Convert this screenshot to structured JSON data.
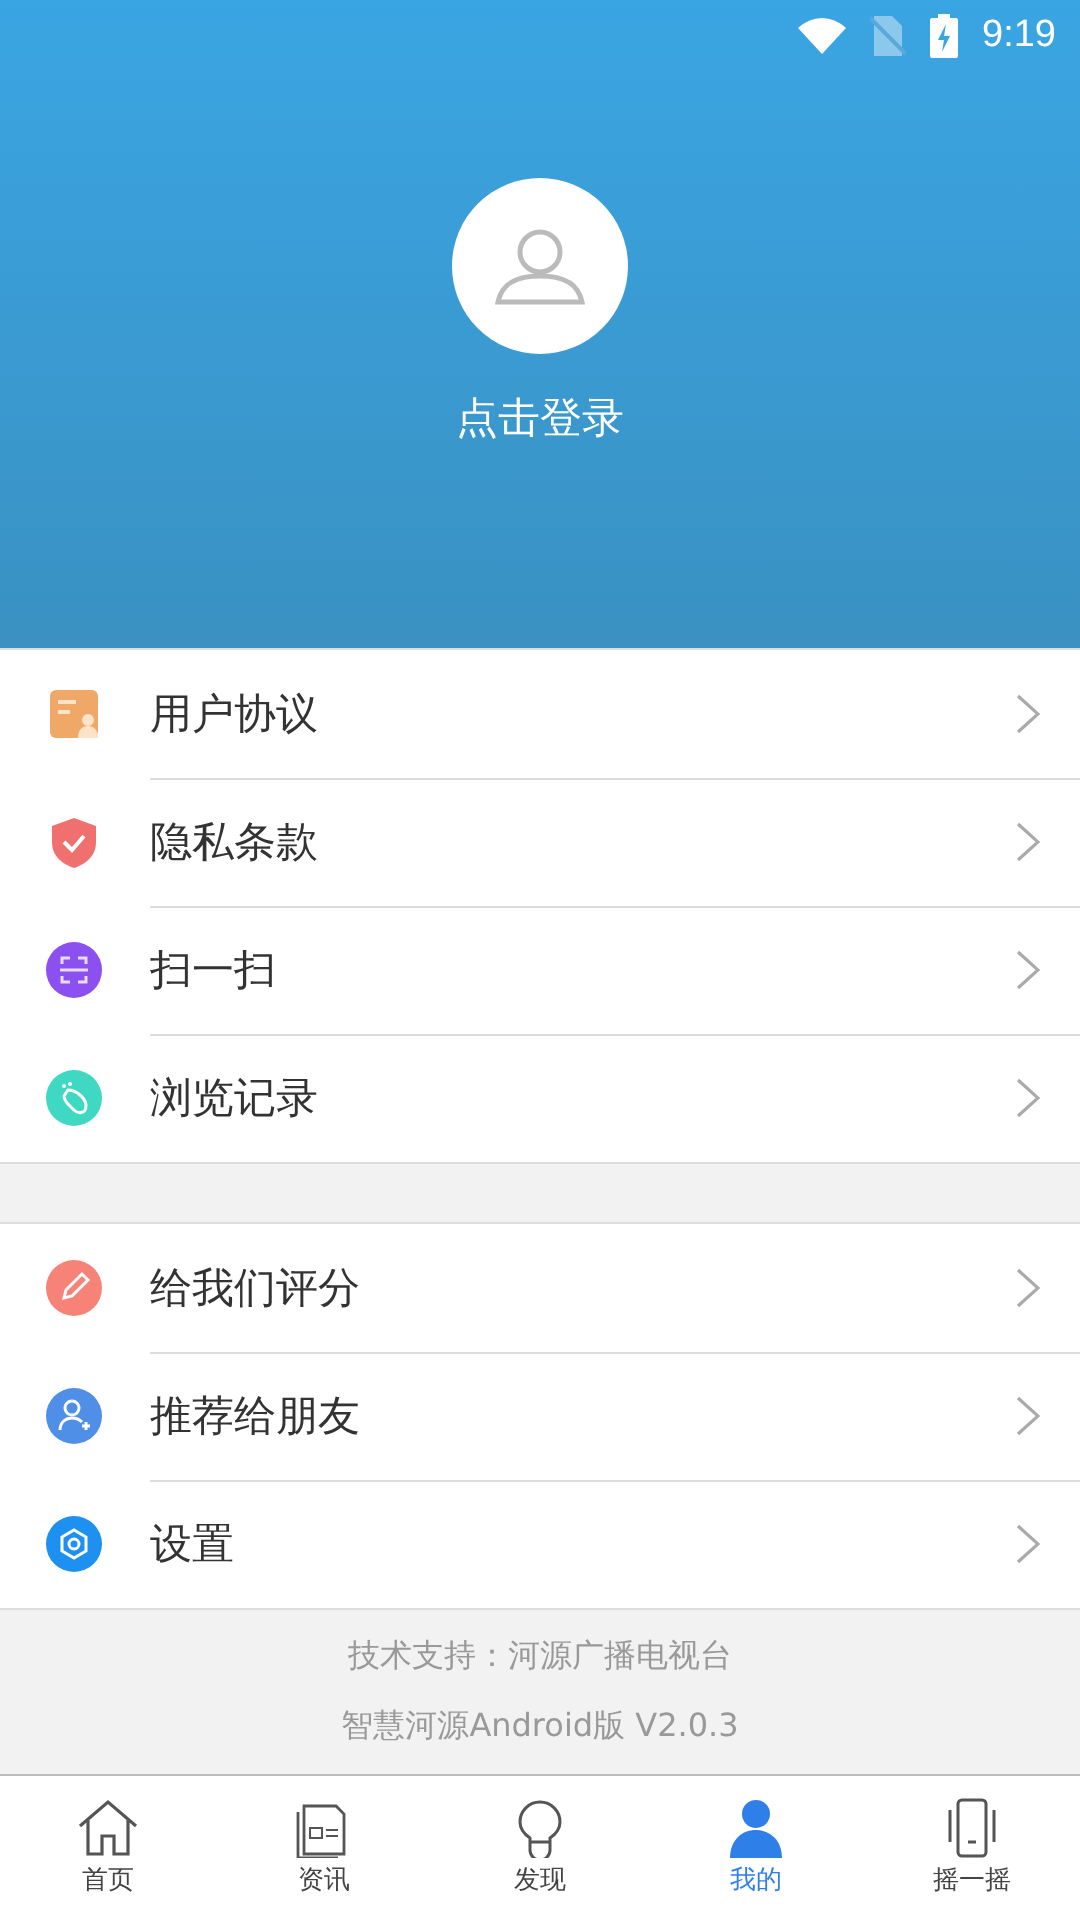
{
  "status_bar": {
    "time": "9:19"
  },
  "profile": {
    "login_label": "点击登录"
  },
  "menu_groups": [
    [
      {
        "kind": "agreement",
        "label": "用户协议"
      },
      {
        "kind": "shield",
        "label": "隐私条款"
      },
      {
        "kind": "scan",
        "label": "扫一扫"
      },
      {
        "kind": "footprint",
        "label": "浏览记录"
      }
    ],
    [
      {
        "kind": "pencil",
        "label": "给我们评分"
      },
      {
        "kind": "adduser",
        "label": "推荐给朋友"
      },
      {
        "kind": "gear",
        "label": "设置"
      }
    ]
  ],
  "footer": {
    "support": "技术支持：河源广播电视台",
    "version": "智慧河源Android版 V2.0.3"
  },
  "bottom_nav": [
    {
      "kind": "home",
      "label": "首页",
      "selected": false
    },
    {
      "kind": "news",
      "label": "资讯",
      "selected": false
    },
    {
      "kind": "bulb",
      "label": "发现",
      "selected": false
    },
    {
      "kind": "person",
      "label": "我的",
      "selected": true
    },
    {
      "kind": "phone",
      "label": "摇一摇",
      "selected": false
    }
  ]
}
